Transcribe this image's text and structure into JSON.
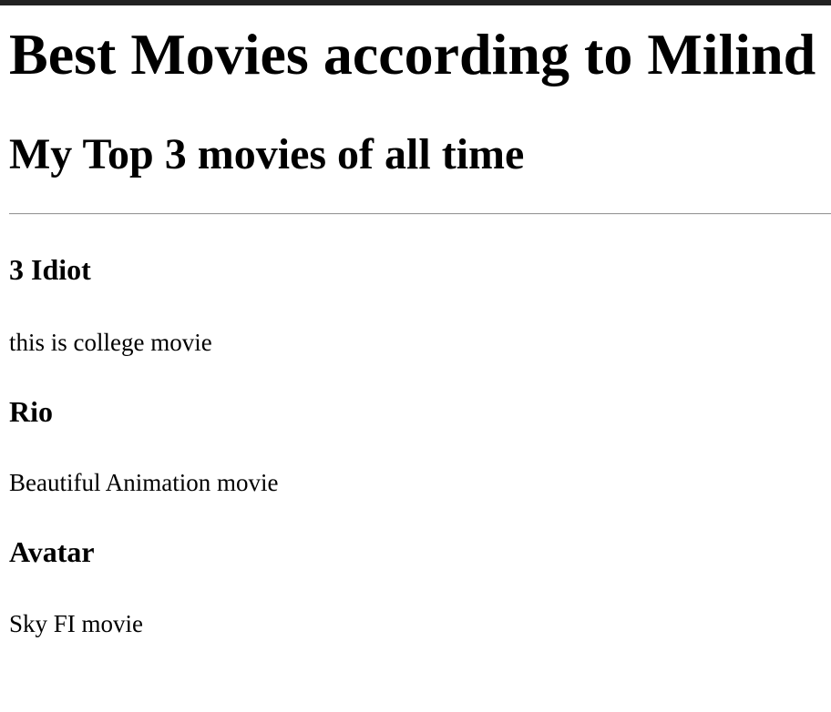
{
  "page": {
    "title": "Best Movies according to Milind",
    "subtitle": "My Top 3 movies of all time"
  },
  "movies": [
    {
      "title": "3 Idiot",
      "description": "this is college movie"
    },
    {
      "title": "Rio",
      "description": "Beautiful Animation movie"
    },
    {
      "title": "Avatar",
      "description": "Sky FI movie"
    }
  ]
}
